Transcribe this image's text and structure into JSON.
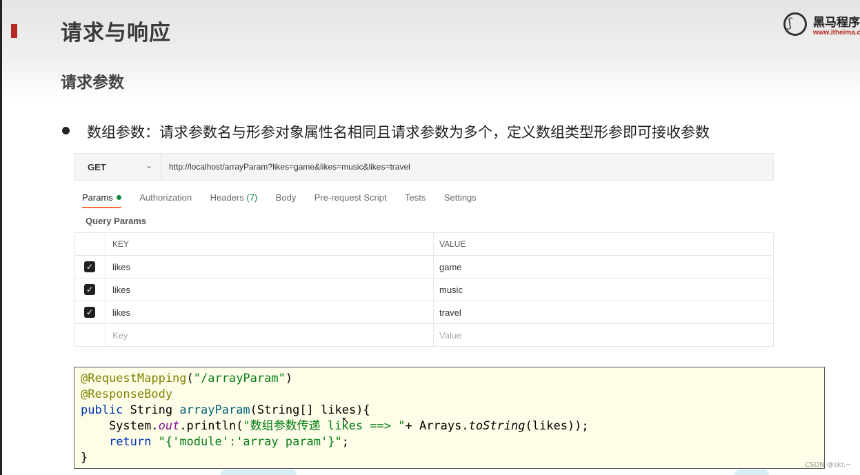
{
  "slide": {
    "title": "请求与响应",
    "subtitle": "请求参数",
    "bullet": "数组参数：请求参数名与形参对象属性名相同且请求参数为多个，定义数组类型形参即可接收参数",
    "logo": {
      "name": "黑马程序",
      "url": "www.itheima.c"
    },
    "watermark": "CSDN @skr.~"
  },
  "postman": {
    "method": "GET",
    "url": "http://localhost/arrayParam?likes=game&likes=music&likes=travel",
    "tabs": [
      {
        "label": "Params",
        "active": true
      },
      {
        "label": "Authorization"
      },
      {
        "label": "Headers",
        "count": "(7)"
      },
      {
        "label": "Body"
      },
      {
        "label": "Pre-request Script"
      },
      {
        "label": "Tests"
      },
      {
        "label": "Settings"
      }
    ],
    "query_params_label": "Query Params",
    "columns": {
      "key": "KEY",
      "value": "VALUE"
    },
    "rows": [
      {
        "key": "likes",
        "value": "game",
        "checked": true
      },
      {
        "key": "likes",
        "value": "music",
        "checked": true
      },
      {
        "key": "likes",
        "value": "travel",
        "checked": true
      }
    ],
    "placeholder": {
      "key": "Key",
      "value": "Value"
    }
  },
  "code": {
    "annotation1": "@RequestMapping",
    "annotation1_arg": "\"/arrayParam\"",
    "annotation2": "@ResponseBody",
    "kw_public": "public",
    "return_type": " String ",
    "method_name": "arrayParam",
    "params": "(String[] likes){",
    "sysout_1": "    System.",
    "sysout_out": "out",
    "sysout_2": ".println(",
    "sysout_str": "\"数组参数传递 likes ==> \"",
    "sysout_3": "+ Arrays.",
    "sysout_method": "toString",
    "sysout_4": "(likes));",
    "ret_indent": "    ",
    "kw_return": "return",
    "ret_str": " \"{'module':'array param'}\"",
    "ret_end": ";",
    "close": "}"
  },
  "colors": {
    "accent_red": "#b32b22",
    "postman_orange": "#ff6c37",
    "params_green": "#0c8a3b",
    "code_bg": "#fdfde8"
  },
  "icons": [
    "logo-icon",
    "bullet-dot-icon",
    "chevron-down-icon",
    "checkbox-checked-icon",
    "mouse-cursor-icon"
  ]
}
